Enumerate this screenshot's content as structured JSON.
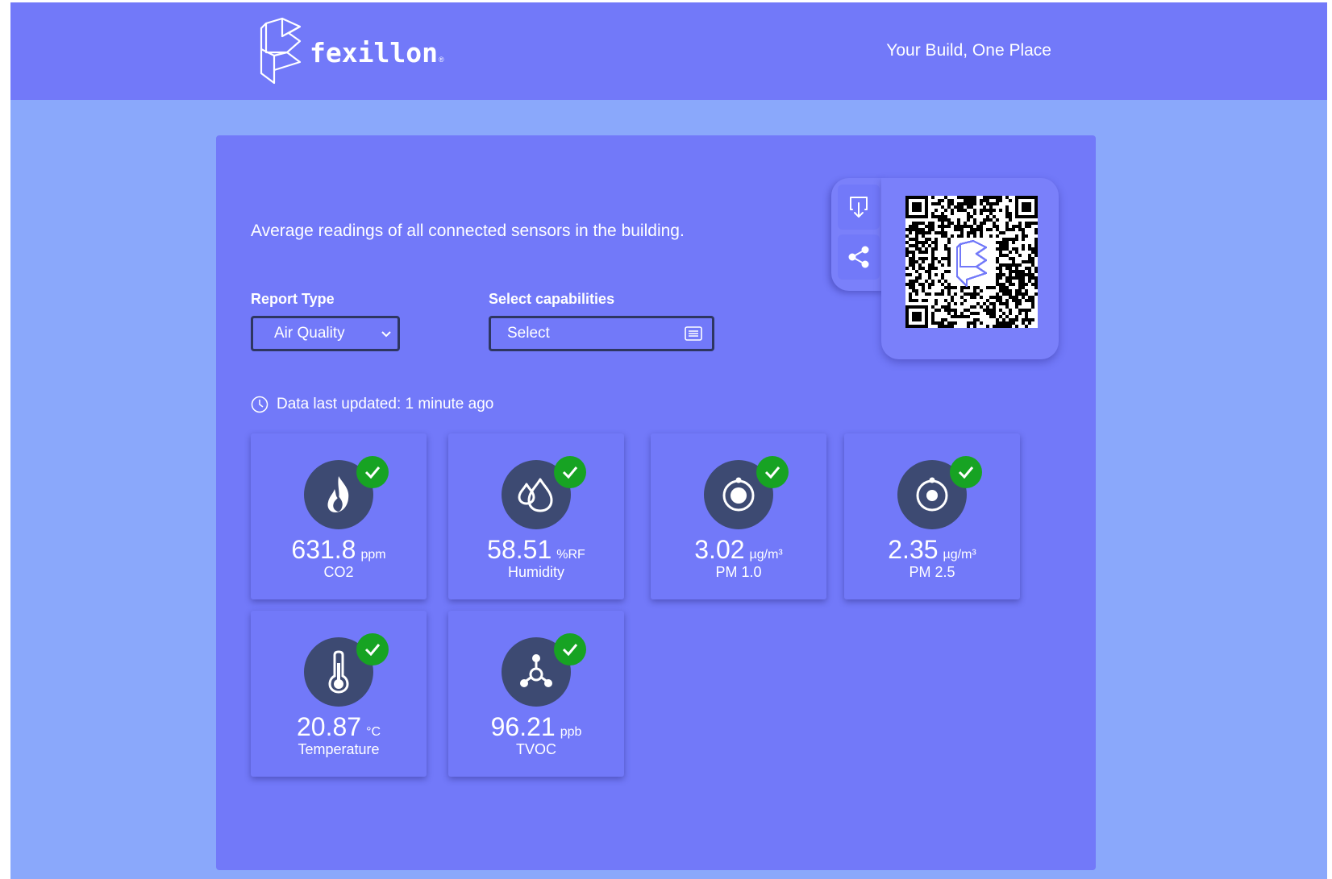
{
  "header": {
    "logo_text": "fexillon",
    "logo_reg": "®",
    "tagline": "Your Build, One Place"
  },
  "main": {
    "intro": "Average readings of all connected sensors in the building.",
    "report_type": {
      "label": "Report Type",
      "selected": "Air Quality"
    },
    "capabilities": {
      "label": "Select capabilities",
      "placeholder": "Select"
    },
    "updated": "Data last updated: 1 minute ago",
    "share": {
      "download_icon": "download-icon",
      "share_icon": "share-icon",
      "qr_icon": "qr-code"
    },
    "readings": [
      {
        "value": "631.8",
        "unit": "ppm",
        "label": "CO2",
        "icon": "flame-icon"
      },
      {
        "value": "58.51",
        "unit": "%RF",
        "label": "Humidity",
        "icon": "droplets-icon"
      },
      {
        "value": "3.02",
        "unit": "µg/m³",
        "label": "PM 1.0",
        "icon": "particle-icon"
      },
      {
        "value": "2.35",
        "unit": "µg/m³",
        "label": "PM 2.5",
        "icon": "particle-icon"
      },
      {
        "value": "20.87",
        "unit": "°C",
        "label": "Temperature",
        "icon": "thermometer-icon"
      },
      {
        "value": "96.21",
        "unit": "ppb",
        "label": "TVOC",
        "icon": "molecule-icon"
      }
    ]
  },
  "colors": {
    "page_bg": "#8aa8fb",
    "header_bg": "#7279f9",
    "panel_bg": "#7279f9",
    "icon_circle": "#3d4a72",
    "status_ok": "#17a323"
  }
}
